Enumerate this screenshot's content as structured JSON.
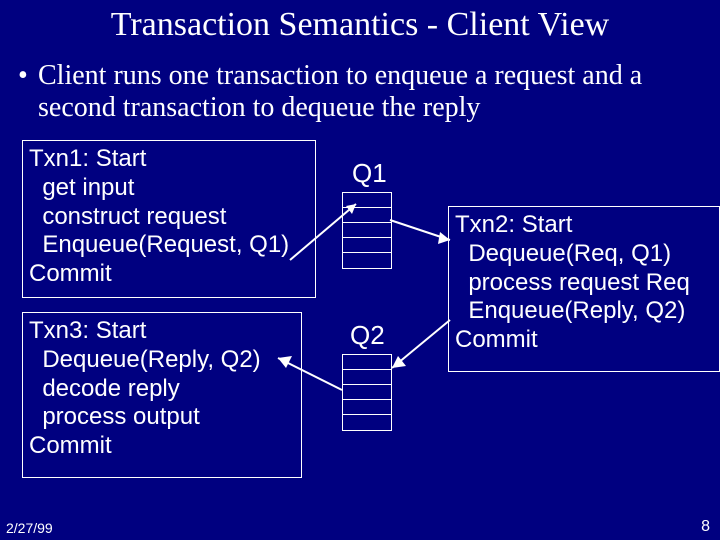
{
  "title": "Transaction Semantics - Client View",
  "bullet": "Client runs one transaction to enqueue a request and a second transaction to dequeue the reply",
  "txn1": "Txn1: Start\n  get input\n  construct request\n  Enqueue(Request, Q1)\nCommit",
  "txn2": "Txn2: Start\n  Dequeue(Req, Q1)\n  process request Req\n  Enqueue(Reply, Q2)\nCommit",
  "txn3": "Txn3: Start\n  Dequeue(Reply, Q2)\n  decode reply\n  process output\nCommit",
  "q1": "Q1",
  "q2": "Q2",
  "date": "2/27/99",
  "page": "8"
}
